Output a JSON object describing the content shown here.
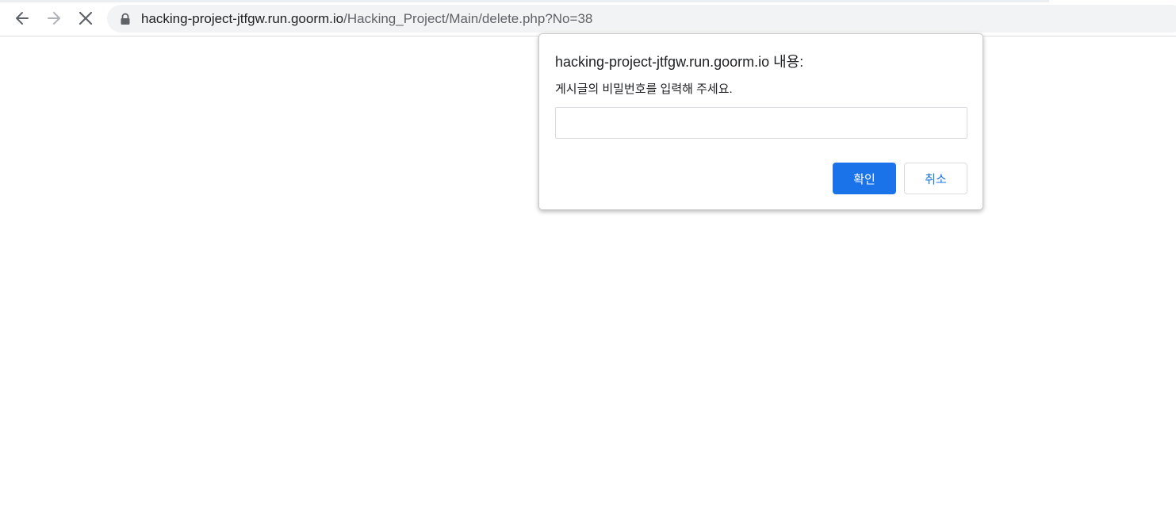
{
  "browser": {
    "icons": {
      "back": "arrow-left-icon",
      "forward": "arrow-right-icon",
      "stop": "close-icon",
      "secure": "lock-icon"
    },
    "address_bar": {
      "host": "hacking-project-jtfgw.run.goorm.io",
      "path": "/Hacking_Project/Main/delete.php?No=38"
    }
  },
  "dialog": {
    "title": "hacking-project-jtfgw.run.goorm.io 내용:",
    "message": "게시글의 비밀번호를 입력해 주세요.",
    "input_value": "",
    "ok_label": "확인",
    "cancel_label": "취소"
  },
  "colors": {
    "accent": "#1a73e8",
    "omnibox_bg": "#f1f3f4",
    "text": "#202124",
    "secondary_text": "#5f6368"
  }
}
